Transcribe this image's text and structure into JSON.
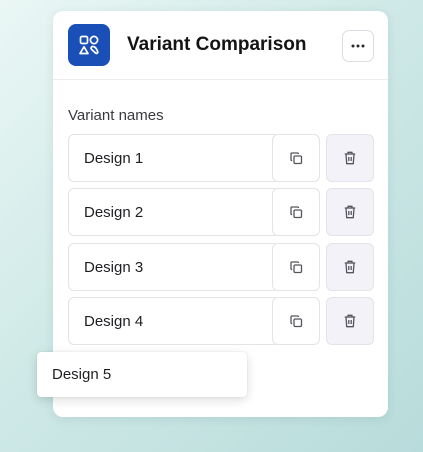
{
  "header": {
    "title": "Variant Comparison",
    "icon": "shapes-icon",
    "icon_bg": "#1a4fb8",
    "more_icon": "more-horizontal-icon"
  },
  "section": {
    "label": "Variant names"
  },
  "variants": [
    {
      "name": "Design 1"
    },
    {
      "name": "Design 2"
    },
    {
      "name": "Design 3"
    },
    {
      "name": "Design 4"
    }
  ],
  "dragging": {
    "name": "Design 5"
  },
  "icons": {
    "copy": "copy-icon",
    "delete": "trash-icon"
  }
}
